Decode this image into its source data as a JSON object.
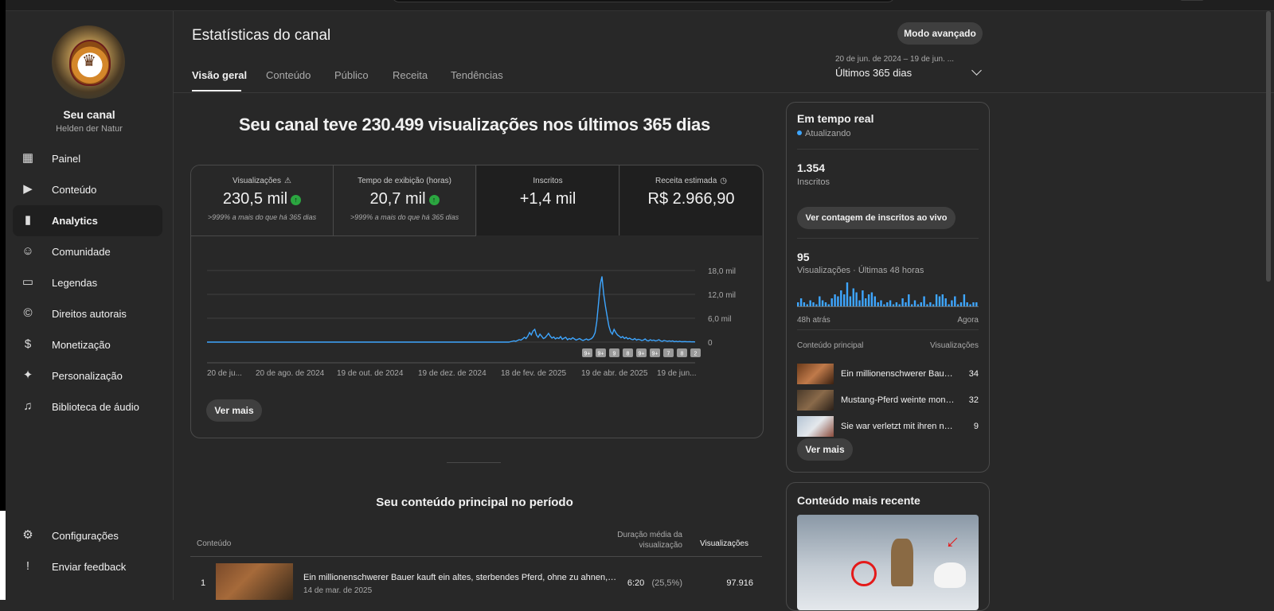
{
  "window": {
    "page_title": "Estatísticas do canal",
    "advanced_mode_label": "Modo avançado"
  },
  "channel": {
    "name": "Seu canal",
    "subtitle": "Helden der Natur"
  },
  "sidebar": {
    "items": [
      {
        "label": "Painel",
        "icon": "dashboard-icon",
        "glyph": "▦"
      },
      {
        "label": "Conteúdo",
        "icon": "content-icon",
        "glyph": "▶"
      },
      {
        "label": "Analytics",
        "icon": "analytics-icon",
        "glyph": "▮",
        "active": true
      },
      {
        "label": "Comunidade",
        "icon": "community-icon",
        "glyph": "☺"
      },
      {
        "label": "Legendas",
        "icon": "subtitles-icon",
        "glyph": "▭"
      },
      {
        "label": "Direitos autorais",
        "icon": "copyright-icon",
        "glyph": "©"
      },
      {
        "label": "Monetização",
        "icon": "dollar-icon",
        "glyph": "$"
      },
      {
        "label": "Personalização",
        "icon": "magic-wand-icon",
        "glyph": "✦"
      },
      {
        "label": "Biblioteca de áudio",
        "icon": "audio-library-icon",
        "glyph": "♫"
      }
    ],
    "bottom_items": [
      {
        "label": "Configurações",
        "icon": "gear-icon",
        "glyph": "⚙"
      },
      {
        "label": "Enviar feedback",
        "icon": "feedback-icon",
        "glyph": "!"
      }
    ]
  },
  "tabs": [
    "Visão geral",
    "Conteúdo",
    "Público",
    "Receita",
    "Tendências"
  ],
  "date_range": {
    "range": "20 de jun. de 2024 – 19 de jun. ...",
    "label": "Últimos 365 dias"
  },
  "headline": "Seu canal teve 230.499 visualizações nos últimos 365 dias",
  "metrics": [
    {
      "title": "Visualizações",
      "value": "230,5 mil",
      "sub": ">999% a mais do que há 365 dias"
    },
    {
      "title": "Tempo de exibição (horas)",
      "value": "20,7 mil",
      "sub": ">999% a mais do que há 365 dias"
    },
    {
      "title": "Inscritos",
      "value": "+1,4 mil",
      "sub": ""
    },
    {
      "title": "Receita estimada",
      "value": "R$ 2.966,90",
      "sub": ""
    }
  ],
  "chart_data": {
    "type": "line",
    "title": "",
    "ylabel": "",
    "yticks": [
      "18,0 mil",
      "12,0 mil",
      "6,0 mil",
      "0"
    ],
    "ylim": [
      0,
      18000
    ],
    "x_labels": [
      "20 de ju...",
      "20 de ago. de 2024",
      "19 de out. de 2024",
      "19 de dez. de 2024",
      "18 de fev. de 2025",
      "19 de abr. de 2025",
      "19 de jun..."
    ],
    "markers": [
      "9+",
      "9+",
      "9",
      "8",
      "9+",
      "9+",
      "7",
      "8",
      "2"
    ],
    "values": [
      0,
      0,
      0,
      0,
      0,
      0,
      0,
      0,
      0,
      0,
      0,
      0,
      0,
      0,
      0,
      0,
      0,
      0,
      0,
      0,
      0,
      0,
      0,
      0,
      0,
      0,
      0,
      0,
      0,
      0,
      0,
      0,
      0,
      0,
      0,
      0,
      0,
      0,
      0,
      0,
      0,
      0,
      0,
      0,
      0,
      0,
      0,
      0,
      0,
      0,
      0,
      0,
      0,
      0,
      0,
      0,
      0,
      0,
      0,
      0,
      0,
      0,
      0,
      0,
      0,
      0,
      0,
      0,
      0,
      0,
      0,
      0,
      0,
      0,
      0,
      0,
      0,
      0,
      0,
      0,
      0,
      0,
      0,
      0,
      0,
      0,
      0,
      0,
      0,
      0,
      0,
      0,
      0,
      0,
      0,
      0,
      0,
      0,
      0,
      0,
      0,
      0,
      0,
      0,
      0,
      0,
      0,
      0,
      0,
      0,
      0,
      0,
      0,
      0,
      0,
      0,
      0,
      0,
      0,
      0,
      0,
      0,
      0,
      0,
      0,
      0,
      0,
      0,
      0,
      0,
      0,
      0,
      0,
      0,
      0,
      0,
      0,
      0,
      0,
      0,
      0,
      0,
      0,
      0,
      0,
      0,
      0,
      0,
      0,
      0,
      0,
      0,
      0,
      0,
      0,
      0,
      0,
      0,
      0,
      0,
      0,
      0,
      0,
      0,
      0,
      0,
      0,
      0,
      0,
      0,
      0,
      0,
      0,
      0,
      0,
      0,
      100,
      200,
      300,
      200,
      400,
      600,
      500,
      800,
      1200,
      900,
      1500,
      2400,
      1800,
      2800,
      3200,
      1800,
      1200,
      2000,
      1500,
      900,
      1100,
      1600,
      2200,
      1500,
      1000,
      1300,
      800,
      1100,
      900,
      1400,
      700,
      1000,
      1200,
      600,
      900,
      700,
      1100,
      800,
      500,
      700,
      900,
      600,
      400,
      600,
      800,
      500,
      700,
      900,
      1400,
      2400,
      5200,
      9800,
      14500,
      16500,
      12000,
      9000,
      6500,
      4000,
      2600,
      2000,
      3200,
      2400,
      1800,
      1500,
      1100,
      1400,
      900,
      1200,
      800,
      1000,
      700,
      600,
      900,
      500,
      700,
      600,
      400,
      500,
      800,
      400,
      300,
      600,
      400,
      500,
      300,
      400,
      600,
      300,
      200,
      400,
      300,
      200,
      300,
      200,
      300,
      100,
      200,
      100,
      200,
      100,
      100,
      150,
      100,
      80,
      100,
      60,
      80,
      50
    ]
  },
  "card_more_label": "Ver mais",
  "top_content": {
    "title": "Seu conteúdo principal no período",
    "col_content": "Conteúdo",
    "col_duration": "Duração média da visualização",
    "col_views": "Visualizações",
    "rows": [
      {
        "rank": "1",
        "title": "Ein millionenschwerer Bauer kauft ein altes, sterbendes Pferd, ohne zu ahnen, we...",
        "date": "14 de mar. de 2025",
        "duration": "6:20",
        "pct": "(25,5%)",
        "views": "97.916"
      }
    ]
  },
  "realtime": {
    "title": "Em tempo real",
    "status": "Atualizando",
    "subs_value": "1.354",
    "subs_label": "Inscritos",
    "live_button": "Ver contagem de inscritos ao vivo",
    "views_value": "95",
    "views_label": "Visualizações · Últimas 48 horas",
    "axis_left": "48h atrás",
    "axis_right": "Agora",
    "bars": [
      2,
      4,
      2,
      1,
      3,
      2,
      1,
      5,
      3,
      2,
      1,
      4,
      6,
      5,
      8,
      6,
      12,
      5,
      9,
      7,
      3,
      8,
      4,
      6,
      7,
      5,
      2,
      3,
      1,
      2,
      3,
      1,
      2,
      1,
      4,
      2,
      6,
      1,
      3,
      1,
      2,
      5,
      1,
      2,
      1,
      6,
      5,
      6,
      4,
      1,
      3,
      5,
      1,
      2,
      6,
      2,
      1,
      2,
      2
    ],
    "top_content_label": "Conteúdo principal",
    "top_views_label": "Visualizações",
    "items": [
      {
        "title": "Ein millionenschwerer Bauer...",
        "views": "34"
      },
      {
        "title": "Mustang-Pferd weinte mona...",
        "views": "32"
      },
      {
        "title": "Sie war verletzt mit ihren neu...",
        "views": "9"
      }
    ],
    "more_label": "Ver mais"
  },
  "recent": {
    "title": "Conteúdo mais recente"
  },
  "colors": {
    "accent": "#3ea6ff",
    "positive": "#2ba640",
    "background": "#282828"
  }
}
